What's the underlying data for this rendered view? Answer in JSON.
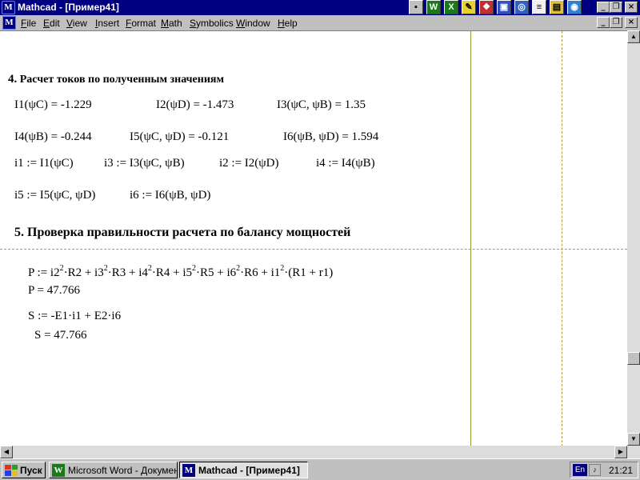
{
  "window": {
    "title": "Mathcad - [Пример41]",
    "app_icon_glyph": "M"
  },
  "toolbar_icons": [
    {
      "name": "palette-icon",
      "glyph": "▪",
      "bg": "#c0c0c0"
    },
    {
      "name": "word-icon",
      "glyph": "W",
      "bg": "#1a7a1a"
    },
    {
      "name": "excel-icon",
      "glyph": "X",
      "bg": "#1a7a1a"
    },
    {
      "name": "key-icon",
      "glyph": "✎",
      "bg": "#e8d030"
    },
    {
      "name": "puzzle-icon",
      "glyph": "❖",
      "bg": "#c03030"
    },
    {
      "name": "image-icon",
      "glyph": "▣",
      "bg": "#3050c0"
    },
    {
      "name": "magnifier-icon",
      "glyph": "◎",
      "bg": "#3060c0"
    },
    {
      "name": "notepad-icon",
      "glyph": "≡",
      "bg": "#f0f0f0"
    },
    {
      "name": "folder-icon",
      "glyph": "▤",
      "bg": "#e0c040"
    },
    {
      "name": "globe-icon",
      "glyph": "◉",
      "bg": "#3080d0"
    }
  ],
  "window_buttons": {
    "minimize": "_",
    "restore": "❐",
    "close": "×"
  },
  "menu": [
    "File",
    "Edit",
    "View",
    "Insert",
    "Format",
    "Math",
    "Symbolics",
    "Window",
    "Help"
  ],
  "worksheet": {
    "heading4_num": "4.",
    "heading4_text": "Расчет токов по полученным значениям",
    "row1": [
      "I1(ψC) = -1.229",
      "I2(ψD) = -1.473",
      "I3(ψC, ψB) = 1.35"
    ],
    "row2": [
      "I4(ψB) = -0.244",
      "I5(ψC, ψD) = -0.121",
      "I6(ψB, ψD) = 1.594"
    ],
    "row3": [
      "i1 := I1(ψC)",
      "i3 := I3(ψC, ψB)",
      "i2 := I2(ψD)",
      "i4 := I4(ψB)"
    ],
    "row4": [
      "i5 := I5(ψC, ψD)",
      "i6 := I6(ψB, ψD)"
    ],
    "heading5": "5. Проверка правильности расчета по балансу мощностей",
    "power": {
      "p_def_prefix": "P := i2",
      "p_exp": "2",
      "p_t1": "·R2 + i3",
      "p_t2": "·R3 + i4",
      "p_t3": "·R4 + i5",
      "p_t4": "·R5 + i6",
      "p_t5": "·R6 + i1",
      "p_t6": "·(R1 + r1)",
      "p_result": "P = 47.766",
      "s_def": "S := -E1·i1 + E2·i6",
      "s_result": "S = 47.766"
    }
  },
  "taskbar": {
    "start_label": "Пуск",
    "tasks": [
      {
        "label": "Microsoft Word - Докумен...",
        "icon": "W",
        "icon_bg": "#1a7a1a"
      },
      {
        "label": "Mathcad - [Пример41]",
        "icon": "M",
        "icon_bg": "#000080"
      }
    ],
    "lang": "En",
    "clock": "21:21"
  }
}
